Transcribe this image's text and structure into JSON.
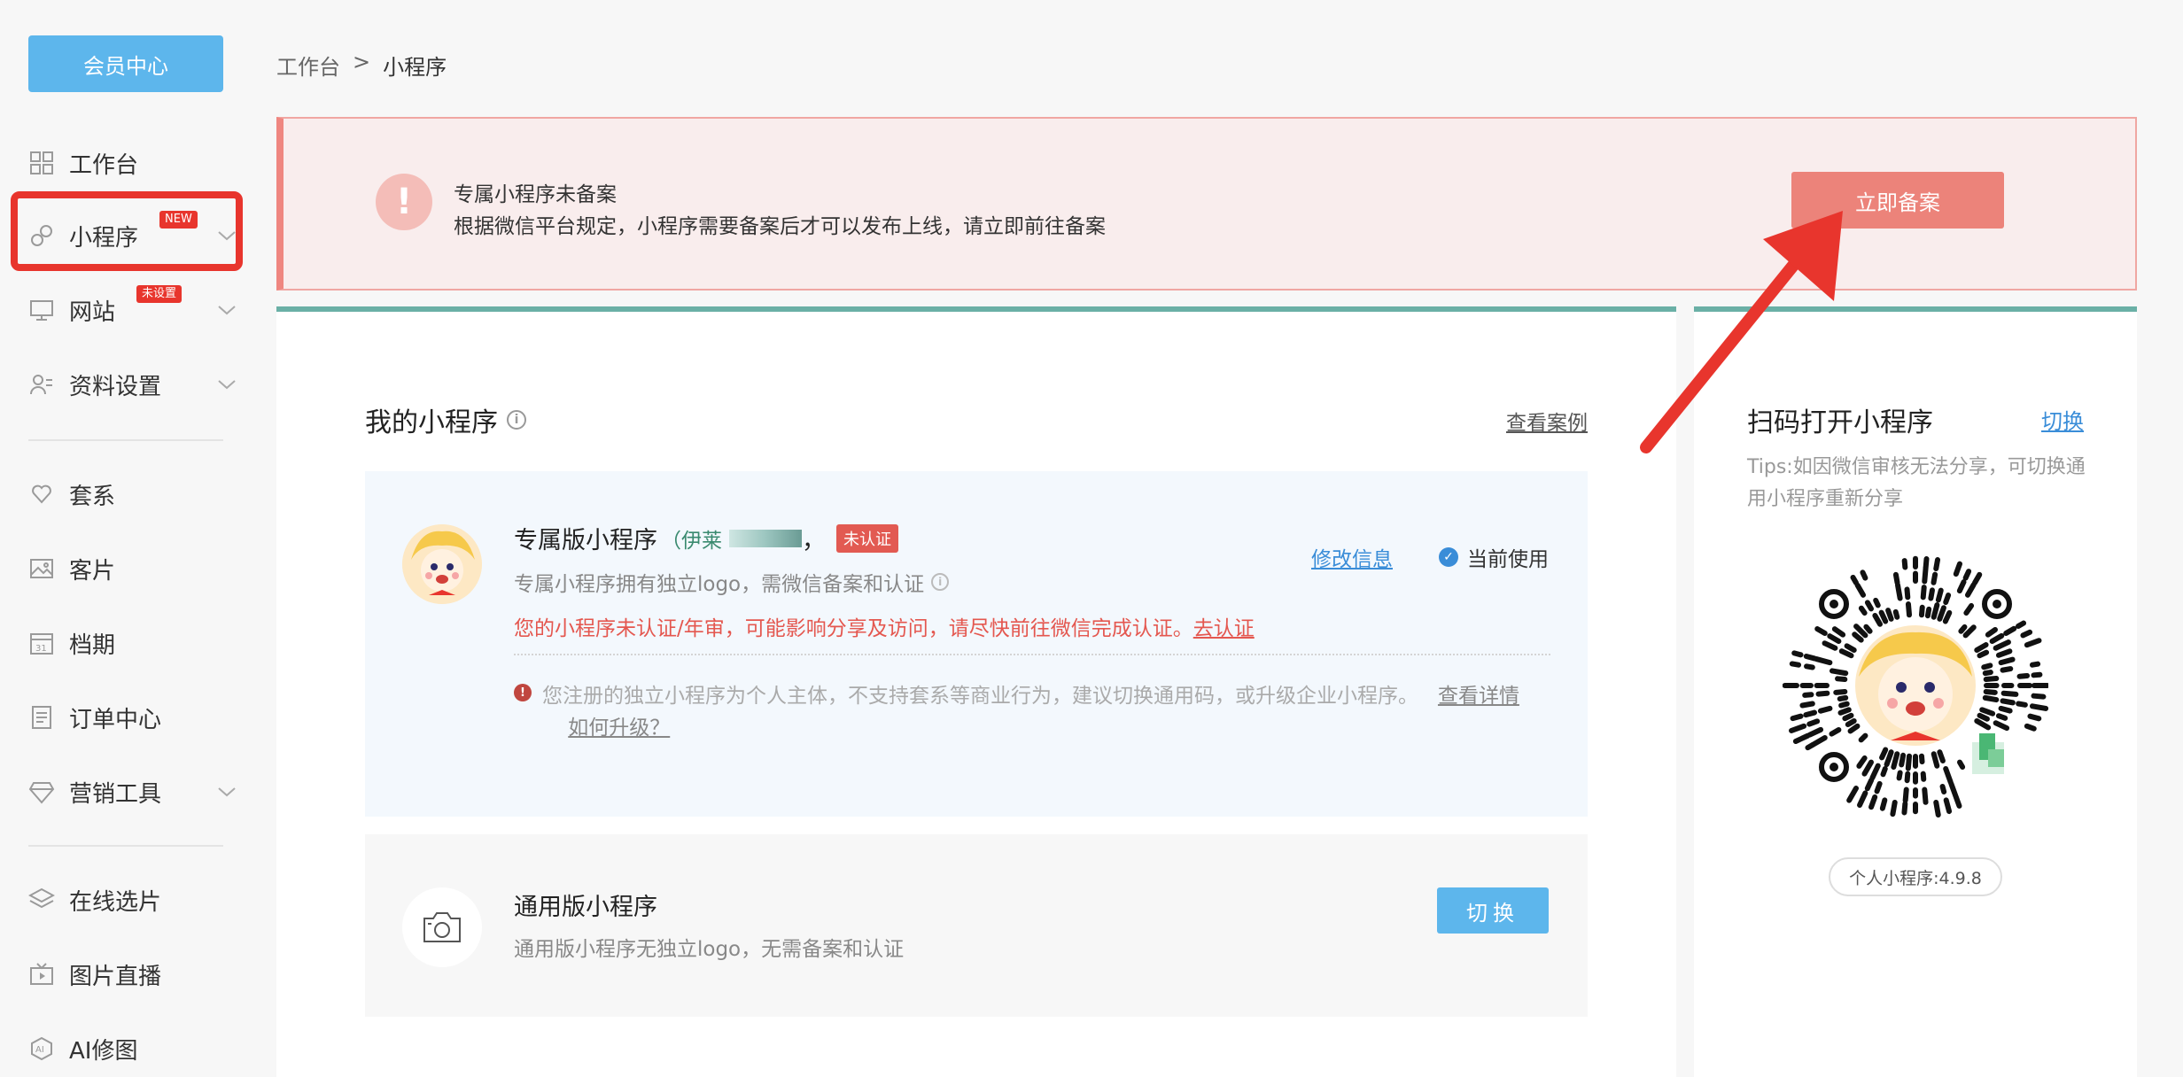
{
  "sidebar": {
    "member_center": "会员中心",
    "items": [
      {
        "label": "工作台"
      },
      {
        "label": "小程序",
        "badge": "NEW"
      },
      {
        "label": "网站",
        "badge": "未设置"
      },
      {
        "label": "资料设置"
      },
      {
        "label": "套系"
      },
      {
        "label": "客片"
      },
      {
        "label": "档期"
      },
      {
        "label": "订单中心"
      },
      {
        "label": "营销工具"
      },
      {
        "label": "在线选片"
      },
      {
        "label": "图片直播"
      },
      {
        "label": "AI修图"
      }
    ]
  },
  "breadcrumb": {
    "root": "工作台",
    "sep": ">",
    "current": "小程序"
  },
  "alert": {
    "title": "专属小程序未备案",
    "desc": "根据微信平台规定，小程序需要备案后才可以发布上线，请立即前往备案",
    "button": "立即备案"
  },
  "main": {
    "title": "我的小程序",
    "case_link": "查看案例",
    "exclusive": {
      "title": "专属版小程序",
      "owner_prefix": "（伊莱",
      "owner_suffix": "，",
      "status_tag": "未认证",
      "desc": "专属小程序拥有独立logo，需微信备案和认证",
      "warn": "您的小程序未认证/年审，可能影响分享及访问，请尽快前往微信完成认证。",
      "warn_link": "去认证",
      "edit_link": "修改信息",
      "current": "当前使用",
      "note": "您注册的独立小程序为个人主体，不支持套系等商业行为，建议切换通用码，或升级企业小程序。",
      "note_link1": "查看详情",
      "note_link2": "如何升级？"
    },
    "general": {
      "title": "通用版小程序",
      "desc": "通用版小程序无独立logo，无需备案和认证",
      "button": "切换"
    }
  },
  "side": {
    "title": "扫码打开小程序",
    "switch": "切换",
    "tips": "Tips:如因微信审核无法分享，可切换通用小程序重新分享",
    "version": "个人小程序:4.9.8"
  },
  "colors": {
    "accent_blue": "#5db6ec",
    "alert_red": "#ec837a",
    "highlight_red": "#e8352d",
    "teal_border": "#6ab0a6"
  }
}
